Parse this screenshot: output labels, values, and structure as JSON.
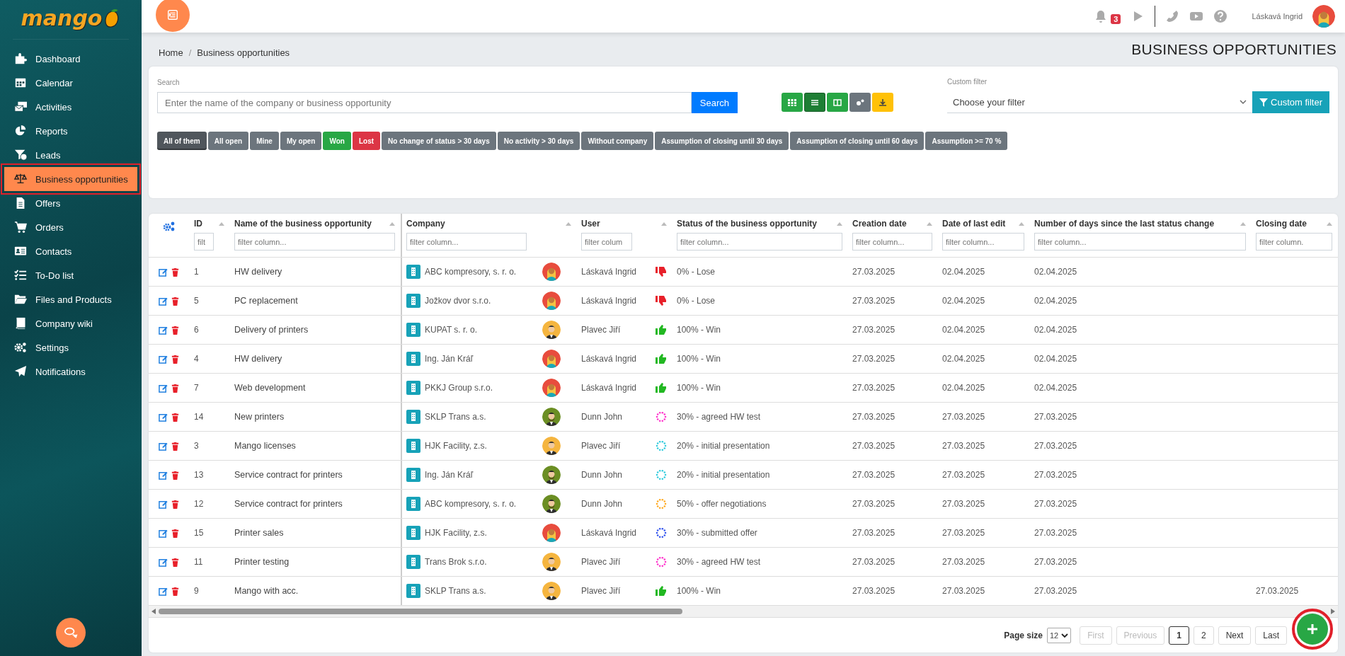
{
  "logo": {
    "text": "mango"
  },
  "sidebar": {
    "items": [
      {
        "label": "Dashboard",
        "selected": false,
        "highlighted": false
      },
      {
        "label": "Calendar",
        "selected": false,
        "highlighted": false
      },
      {
        "label": "Activities",
        "selected": false,
        "highlighted": false
      },
      {
        "label": "Reports",
        "selected": false,
        "highlighted": false
      },
      {
        "label": "Leads",
        "selected": false,
        "highlighted": false
      },
      {
        "label": "Business opportunities",
        "selected": true,
        "highlighted": true
      },
      {
        "label": "Offers",
        "selected": false,
        "highlighted": false
      },
      {
        "label": "Orders",
        "selected": false,
        "highlighted": false
      },
      {
        "label": "Contacts",
        "selected": false,
        "highlighted": false
      },
      {
        "label": "To-Do list",
        "selected": false,
        "highlighted": false
      },
      {
        "label": "Files and Products",
        "selected": false,
        "highlighted": false
      },
      {
        "label": "Company wiki",
        "selected": false,
        "highlighted": false
      },
      {
        "label": "Settings",
        "selected": false,
        "highlighted": false
      },
      {
        "label": "Notifications",
        "selected": false,
        "highlighted": false
      }
    ]
  },
  "topbar": {
    "notification_count": "3",
    "user_name": "Láskavá Ingrid"
  },
  "breadcrumb": {
    "items": [
      "Home",
      "Business opportunities"
    ],
    "separator": "/"
  },
  "page_title": "BUSINESS OPPORTUNITIES",
  "search": {
    "label": "Search",
    "placeholder": "Enter the name of the company or business opportunity",
    "button": "Search"
  },
  "view_buttons": [
    {
      "kind": "grid",
      "color": "#28a745",
      "selected": false
    },
    {
      "kind": "list",
      "color": "#1e7e34",
      "selected": true
    },
    {
      "kind": "columns",
      "color": "#28a745",
      "selected": false
    },
    {
      "kind": "gears",
      "color": "#6c757d",
      "selected": false
    },
    {
      "kind": "download",
      "color": "#ffc107",
      "selected": false
    }
  ],
  "custom_filter": {
    "label": "Custom filter",
    "placeholder": "Choose your filter",
    "button": "Custom filter"
  },
  "quick_filters": [
    {
      "label": "All of them",
      "color": "#50565c",
      "selected": true
    },
    {
      "label": "All open",
      "color": "#6c757d",
      "selected": false
    },
    {
      "label": "Mine",
      "color": "#6c757d",
      "selected": false
    },
    {
      "label": "My open",
      "color": "#6c757d",
      "selected": false
    },
    {
      "label": "Won",
      "color": "#28a745",
      "selected": false
    },
    {
      "label": "Lost",
      "color": "#dc3545",
      "selected": false
    },
    {
      "label": "No change of status > 30 days",
      "color": "#6c757d",
      "selected": false
    },
    {
      "label": "No activity > 30 days",
      "color": "#6c757d",
      "selected": false
    },
    {
      "label": "Without company",
      "color": "#6c757d",
      "selected": false
    },
    {
      "label": "Assumption of closing until 30 days",
      "color": "#6c757d",
      "selected": false
    },
    {
      "label": "Assumption of closing until 60 days",
      "color": "#6c757d",
      "selected": false
    },
    {
      "label": "Assumption >= 70 %",
      "color": "#6c757d",
      "selected": false
    }
  ],
  "table": {
    "columns": [
      {
        "label": "ID",
        "filter_placeholder": "filt"
      },
      {
        "label": "Name of the business opportunity",
        "filter_placeholder": "filter column..."
      },
      {
        "label": "Company",
        "filter_placeholder": "filter column..."
      },
      {
        "label": "User",
        "filter_placeholder": "filter colum"
      },
      {
        "label": "Status of the business opportunity",
        "filter_placeholder": "filter column..."
      },
      {
        "label": "Creation date",
        "filter_placeholder": "filter column..."
      },
      {
        "label": "Date of last edit",
        "filter_placeholder": "filter column..."
      },
      {
        "label": "Number of days since the last status change",
        "filter_placeholder": "filter column..."
      },
      {
        "label": "Closing date",
        "filter_placeholder": "filter column."
      }
    ],
    "rows": [
      {
        "id": "1",
        "name": "HW delivery",
        "company": "ABC kompresory, s. r. o.",
        "user": {
          "name": "Láskavá Ingrid",
          "kind": "woman"
        },
        "status": {
          "text": "0% - Lose",
          "kind": "thumbs-down"
        },
        "created": "27.03.2025",
        "edited": "02.04.2025",
        "days": "02.04.2025"
      },
      {
        "id": "5",
        "name": "PC replacement",
        "company": "Jožkov dvor s.r.o.",
        "user": {
          "name": "Láskavá Ingrid",
          "kind": "woman"
        },
        "status": {
          "text": "0% - Lose",
          "kind": "thumbs-down"
        },
        "created": "27.03.2025",
        "edited": "02.04.2025",
        "days": "02.04.2025"
      },
      {
        "id": "6",
        "name": "Delivery of printers",
        "company": "KUPAT s. r. o.",
        "user": {
          "name": "Plavec Jiří",
          "kind": "man"
        },
        "status": {
          "text": "100% - Win",
          "kind": "thumbs-up"
        },
        "created": "27.03.2025",
        "edited": "02.04.2025",
        "days": "02.04.2025"
      },
      {
        "id": "4",
        "name": "HW delivery",
        "company": "Ing. Ján Kráľ",
        "user": {
          "name": "Láskavá Ingrid",
          "kind": "woman"
        },
        "status": {
          "text": "100% - Win",
          "kind": "thumbs-up"
        },
        "created": "27.03.2025",
        "edited": "02.04.2025",
        "days": "02.04.2025"
      },
      {
        "id": "7",
        "name": "Web development",
        "company": "PKKJ Group s.r.o.",
        "user": {
          "name": "Láskavá Ingrid",
          "kind": "woman"
        },
        "status": {
          "text": "100% - Win",
          "kind": "thumbs-up"
        },
        "created": "27.03.2025",
        "edited": "02.04.2025",
        "days": "02.04.2025"
      },
      {
        "id": "14",
        "name": "New printers",
        "company": "SKLP Trans a.s.",
        "user": {
          "name": "Dunn John",
          "kind": "bearded-man"
        },
        "status": {
          "text": "30% - agreed HW test",
          "kind": "progress",
          "color": "#ff33cc"
        },
        "created": "27.03.2025",
        "edited": "27.03.2025",
        "days": "27.03.2025"
      },
      {
        "id": "3",
        "name": "Mango licenses",
        "company": "HJK Facility, z.s.",
        "user": {
          "name": "Plavec Jiří",
          "kind": "man"
        },
        "status": {
          "text": "20% - initial presentation",
          "kind": "progress",
          "color": "#33ccdd"
        },
        "created": "27.03.2025",
        "edited": "27.03.2025",
        "days": "27.03.2025"
      },
      {
        "id": "13",
        "name": "Service contract for printers",
        "company": "Ing. Ján Kráľ",
        "user": {
          "name": "Dunn John",
          "kind": "bearded-man"
        },
        "status": {
          "text": "20% - initial presentation",
          "kind": "progress",
          "color": "#33ccdd"
        },
        "created": "27.03.2025",
        "edited": "27.03.2025",
        "days": "27.03.2025"
      },
      {
        "id": "12",
        "name": "Service contract for printers",
        "company": "ABC kompresory, s. r. o.",
        "user": {
          "name": "Dunn John",
          "kind": "bearded-man"
        },
        "status": {
          "text": "50% - offer negotiations",
          "kind": "progress",
          "color": "#ffaa22"
        },
        "created": "27.03.2025",
        "edited": "27.03.2025",
        "days": "27.03.2025"
      },
      {
        "id": "15",
        "name": "Printer sales",
        "company": "HJK Facility, z.s.",
        "user": {
          "name": "Láskavá Ingrid",
          "kind": "woman"
        },
        "status": {
          "text": "30% - submitted offer",
          "kind": "progress",
          "color": "#3355ee"
        },
        "created": "27.03.2025",
        "edited": "27.03.2025",
        "days": "27.03.2025"
      },
      {
        "id": "11",
        "name": "Printer testing",
        "company": "Trans Brok s.r.o.",
        "user": {
          "name": "Plavec Jiří",
          "kind": "man"
        },
        "status": {
          "text": "30% - agreed HW test",
          "kind": "progress",
          "color": "#ff33cc"
        },
        "created": "27.03.2025",
        "edited": "27.03.2025",
        "days": "27.03.2025"
      },
      {
        "id": "9",
        "name": "Mango with acc.",
        "company": "SKLP Trans a.s.",
        "user": {
          "name": "Plavec Jiří",
          "kind": "man"
        },
        "status": {
          "text": "100% - Win",
          "kind": "thumbs-up"
        },
        "created": "27.03.2025",
        "edited": "27.03.2025",
        "days": "27.03.2025",
        "closing": "27.03.2025"
      }
    ]
  },
  "pagination": {
    "page_size_label": "Page size",
    "page_size": "12",
    "buttons": [
      {
        "label": "First",
        "disabled": true
      },
      {
        "label": "Previous",
        "disabled": true
      }
    ],
    "pages": [
      {
        "label": "1",
        "selected": true
      },
      {
        "label": "2",
        "selected": false
      }
    ],
    "end_buttons": [
      {
        "label": "Next",
        "disabled": false
      },
      {
        "label": "Last",
        "disabled": false
      }
    ]
  },
  "add_button": {
    "highlighted": true
  }
}
